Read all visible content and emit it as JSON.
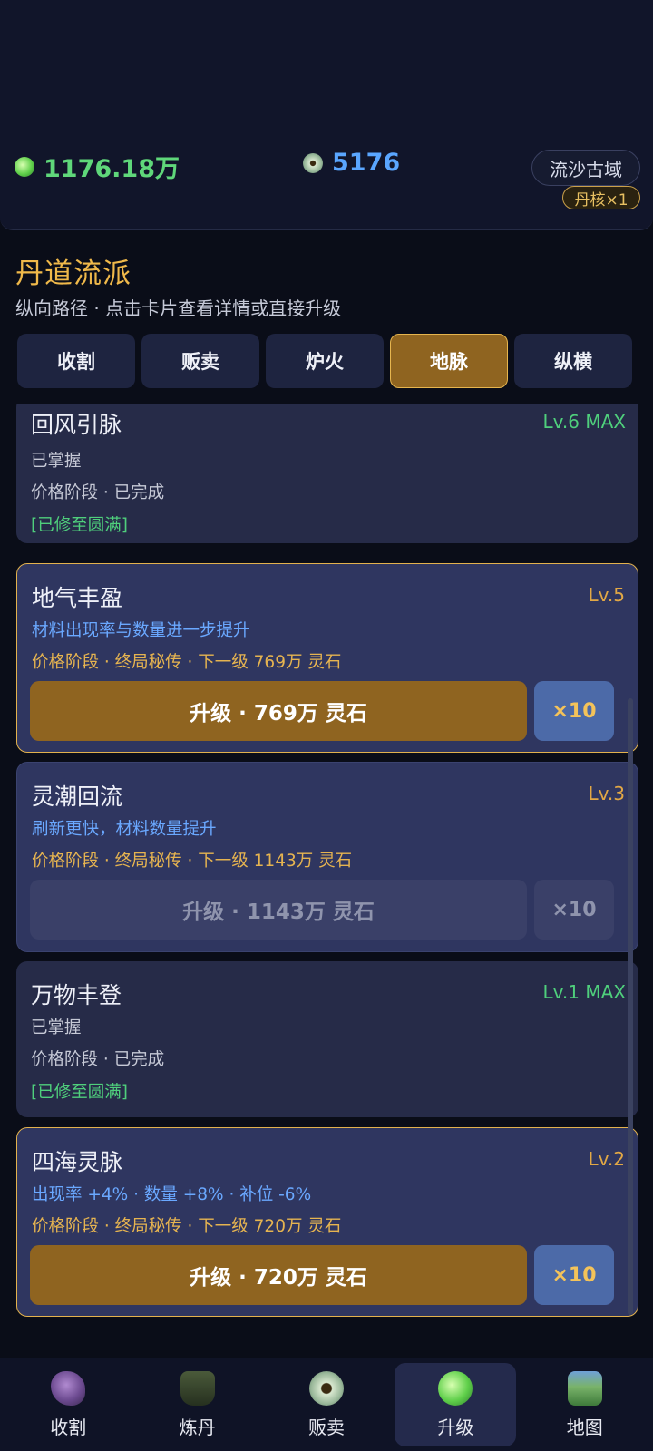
{
  "header": {
    "spirit_stone": "1176.18万",
    "pellet_currency": "5176",
    "region_button": "流沙古域",
    "core_badge": "丹核×1"
  },
  "section": {
    "title": "丹道流派",
    "subtitle": "纵向路径 · 点击卡片查看详情或直接升级"
  },
  "tabs": [
    {
      "label": "收割",
      "active": false
    },
    {
      "label": "贩卖",
      "active": false
    },
    {
      "label": "炉火",
      "active": false
    },
    {
      "label": "地脉",
      "active": true
    },
    {
      "label": "纵横",
      "active": false
    }
  ],
  "cards": [
    {
      "name": "回风引脉",
      "level": "Lv.6 MAX",
      "status": "已掌握",
      "price_stage": "价格阶段 · 已完成",
      "done_tag": "[已修至圆满]"
    },
    {
      "name": "地气丰盈",
      "level": "Lv.5",
      "desc": "材料出现率与数量进一步提升",
      "price_stage": "价格阶段 · 终局秘传 · 下一级 769万 灵石",
      "upgrade_label": "升级 · 769万 灵石",
      "x10_label": "×10"
    },
    {
      "name": "灵潮回流",
      "level": "Lv.3",
      "desc": "刷新更快，材料数量提升",
      "price_stage": "价格阶段 · 终局秘传 · 下一级 1143万 灵石",
      "upgrade_label": "升级 · 1143万 灵石",
      "x10_label": "×10"
    },
    {
      "name": "万物丰登",
      "level": "Lv.1 MAX",
      "status": "已掌握",
      "price_stage": "价格阶段 · 已完成",
      "done_tag": "[已修至圆满]"
    },
    {
      "name": "四海灵脉",
      "level": "Lv.2",
      "desc": "出现率 +4% · 数量 +8% · 补位 -6%",
      "price_stage": "价格阶段 · 终局秘传 · 下一级 720万 灵石",
      "upgrade_label": "升级 · 720万 灵石",
      "x10_label": "×10"
    }
  ],
  "bottom_nav": [
    {
      "label": "收割",
      "icon": "harvest-icon",
      "active": false
    },
    {
      "label": "炼丹",
      "icon": "alchemy-cauldron-icon",
      "active": false
    },
    {
      "label": "贩卖",
      "icon": "sell-coin-icon",
      "active": false
    },
    {
      "label": "升级",
      "icon": "upgrade-orb-icon",
      "active": true
    },
    {
      "label": "地图",
      "icon": "map-icon",
      "active": false
    }
  ]
}
